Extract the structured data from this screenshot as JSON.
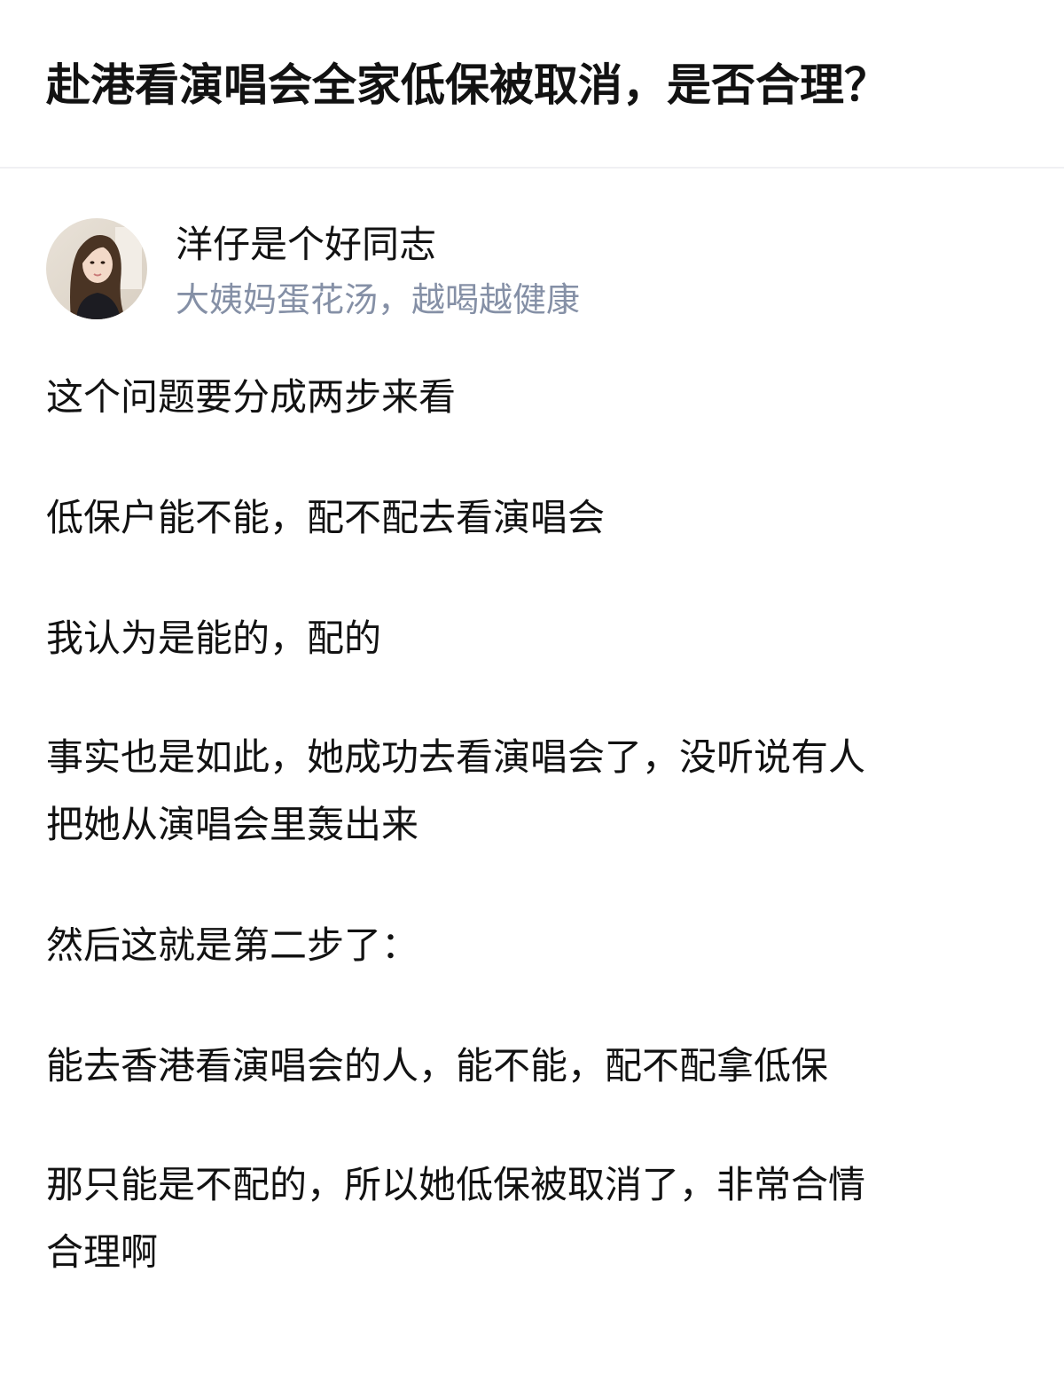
{
  "question": {
    "title": "赴港看演唱会全家低保被取消，是否合理？"
  },
  "author": {
    "name": "洋仔是个好同志",
    "headline": "大姨妈蛋花汤，越喝越健康",
    "avatar_icon": "user-avatar-photo"
  },
  "answer": {
    "paragraphs": [
      {
        "lines": [
          "这个问题要分成两步来看"
        ]
      },
      {
        "lines": [
          "低保户能不能，配不配去看演唱会"
        ]
      },
      {
        "lines": [
          "我认为是能的，配的"
        ]
      },
      {
        "lines": [
          "事实也是如此，她成功去看演唱会了，没听说有人",
          "把她从演唱会里轰出来"
        ]
      },
      {
        "lines": [
          "然后这就是第二步了："
        ]
      },
      {
        "lines": [
          "能去香港看演唱会的人，能不能，配不配拿低保"
        ]
      },
      {
        "lines": [
          "那只能是不配的，所以她低保被取消了，非常合情",
          "合理啊"
        ]
      }
    ]
  },
  "colors": {
    "text": "#121212",
    "secondary_text": "#8590a6",
    "divider": "#f0f0f3"
  }
}
